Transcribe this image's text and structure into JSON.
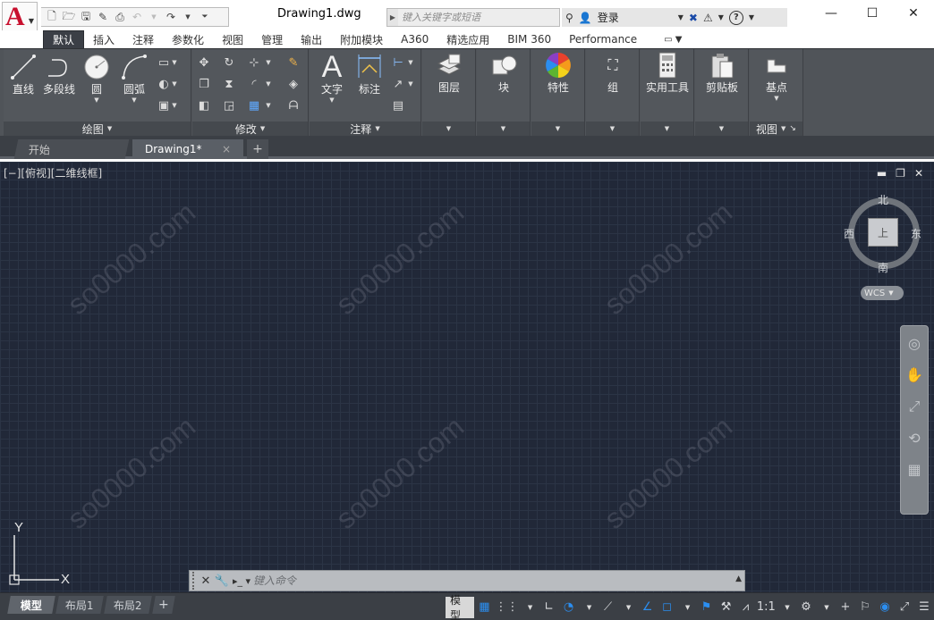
{
  "window": {
    "title": "Drawing1.dwg",
    "controls": [
      "—",
      "☐",
      "✕"
    ]
  },
  "app_button": {
    "logo": "A",
    "icon": "autocad-logo-icon"
  },
  "quick_access": {
    "icons": [
      "new-icon",
      "open-icon",
      "save-icon",
      "save-as-icon",
      "print-icon",
      "undo-icon",
      "redo-icon",
      "customize-icon"
    ]
  },
  "search": {
    "placeholder": "键入关键字或短语"
  },
  "help": {
    "login": "登录"
  },
  "ribbon_tabs": [
    "默认",
    "插入",
    "注释",
    "参数化",
    "视图",
    "管理",
    "输出",
    "附加模块",
    "A360",
    "精选应用",
    "BIM 360",
    "Performance"
  ],
  "ribbon_active_tab": "默认",
  "panels": {
    "draw": {
      "title": "绘图",
      "line": "直线",
      "polyline": "多段线",
      "circle": "圆",
      "arc": "圆弧"
    },
    "modify": {
      "title": "修改"
    },
    "annotation": {
      "title": "注释",
      "text": "文字",
      "dimension": "标注"
    },
    "layers": {
      "label": "图层"
    },
    "block": {
      "label": "块"
    },
    "properties": {
      "label": "特性"
    },
    "groups": {
      "label": "组"
    },
    "utilities": {
      "label": "实用工具"
    },
    "clipboard": {
      "label": "剪贴板"
    },
    "view": {
      "title": "视图",
      "base": "基点"
    }
  },
  "file_tabs": {
    "start": "开始",
    "drawing": "Drawing1*",
    "close": "×",
    "new": "+"
  },
  "viewport": {
    "label": "[−][俯视][二维线框]",
    "controls": [
      "▬",
      "❐",
      "✕"
    ]
  },
  "viewcube": {
    "north": "北",
    "south": "南",
    "east": "东",
    "west": "西",
    "face": "上",
    "wcs": "WCS"
  },
  "ucs": {
    "x": "X",
    "y": "Y"
  },
  "watermark": "so0000.com",
  "command_line": {
    "placeholder": "键入命令"
  },
  "layout_tabs": {
    "model": "模型",
    "layout1": "布局1",
    "layout2": "布局2",
    "add": "+"
  },
  "status_bar": {
    "model": "模型",
    "scale": "1:1"
  },
  "colors": {
    "canvas": "#212838",
    "ribbon": "#53575c",
    "accent": "#2b8ef0",
    "logo": "#c8102e"
  }
}
